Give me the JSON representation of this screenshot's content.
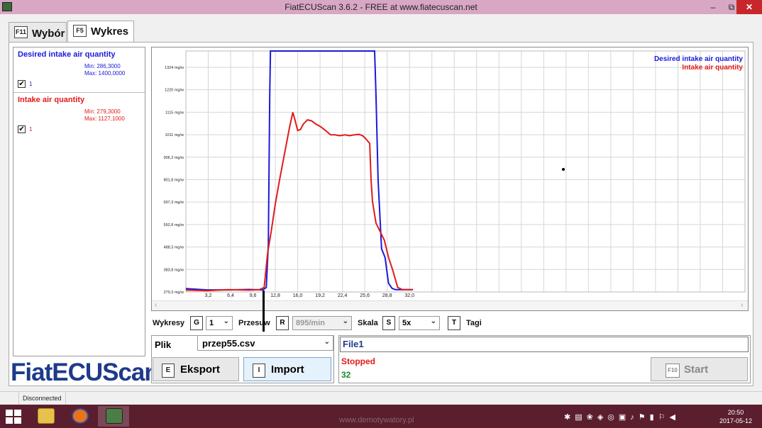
{
  "window": {
    "title": "FiatECUScan 3.6.2 - FREE at www.fiatecuscan.net",
    "min_glyph": "–",
    "max_glyph": "⧉",
    "close_glyph": "✕"
  },
  "tabs": [
    {
      "key": "F11",
      "label": "Wybór",
      "active": false
    },
    {
      "key": "F5",
      "label": "Wykres",
      "active": true
    }
  ],
  "legend": [
    {
      "name": "Desired intake air quantity",
      "color": "#1a1adb",
      "min": "Min: 286,3000",
      "max": "Max: 1400,0000",
      "checked": true,
      "num": "1",
      "check_glyph": "✔"
    },
    {
      "name": "Intake air quantity",
      "color": "#e01b1b",
      "min": "Min: 279,3000",
      "max": "Max: 1127,1000",
      "checked": true,
      "num": "1",
      "check_glyph": "✔"
    }
  ],
  "logo": "FiatECUScan",
  "chart_data": {
    "type": "line",
    "x_ticks": [
      "3,2",
      "6,4",
      "9,6",
      "12,8",
      "16,0",
      "19,2",
      "22,4",
      "25,6",
      "28,8",
      "32,0"
    ],
    "y_ticks": [
      "279,3 mg/w",
      "383,8 mg/w",
      "488,3 mg/w",
      "592,8 mg/w",
      "697,3 mg/w",
      "801,8 mg/w",
      "906,3 mg/w",
      "1011 mg/w",
      "1115 mg/w",
      "1220 mg/w",
      "1324 mg/w"
    ],
    "xlim": [
      0,
      80
    ],
    "ylim": [
      279.3,
      1400
    ],
    "grid": true,
    "legend_position": "top-right",
    "series": [
      {
        "name": "Desired intake air quantity",
        "color": "#1a1adb",
        "x": [
          0,
          3,
          6,
          9,
          11,
          11.5,
          11.8,
          12,
          12.1,
          27,
          27.2,
          27.5,
          28,
          28.5,
          29,
          29.5,
          30,
          31,
          32.5
        ],
        "y": [
          295,
          289,
          289,
          291,
          289,
          300,
          500,
          1200,
          1400,
          1400,
          1200,
          800,
          480,
          440,
          320,
          296,
          290,
          290,
          290
        ]
      },
      {
        "name": "Intake air quantity",
        "color": "#e01b1b",
        "x": [
          0,
          3,
          6,
          9,
          10.5,
          11.2,
          11.7,
          12.2,
          12.8,
          13.4,
          14.1,
          14.8,
          15.3,
          15.6,
          16.0,
          16.4,
          16.8,
          17.4,
          18.0,
          18.6,
          19.2,
          20.0,
          20.7,
          21.3,
          22.0,
          22.8,
          23.4,
          24.1,
          24.8,
          25.3,
          25.8,
          26.3,
          26.5,
          26.7,
          27.2,
          27.8,
          28.4,
          29.0,
          29.6,
          30.3,
          31.0,
          32.5
        ],
        "y": [
          288,
          285,
          290,
          288,
          290,
          300,
          460,
          560,
          690,
          800,
          920,
          1040,
          1115,
          1080,
          1030,
          1035,
          1060,
          1080,
          1075,
          1060,
          1050,
          1030,
          1010,
          1010,
          1006,
          1010,
          1006,
          1010,
          1012,
          1006,
          990,
          970,
          800,
          700,
          600,
          560,
          520,
          440,
          380,
          300,
          290,
          290
        ]
      }
    ]
  },
  "controls": {
    "wykresy_label": "Wykresy",
    "wykresy_key": "G",
    "wykresy_value": "1",
    "przesuw_label": "Przesuw",
    "przesuw_key": "R",
    "przesuw_value": "895/min",
    "skala_label": "Skala",
    "skala_key": "S",
    "skala_value": "5x",
    "tagi_key": "T",
    "tagi_label": "Tagi",
    "chev": "⌄"
  },
  "file": {
    "plik_label": "Plik",
    "selected": "przep55.csv",
    "eksport_key": "E",
    "eksport_label": "Eksport",
    "import_key": "I",
    "import_label": "Import",
    "filename": "File1",
    "status": "Stopped",
    "count": "32",
    "start_key": "F10",
    "start_label": "Start"
  },
  "statusbar": {
    "connection": "Disconnected"
  },
  "taskbar": {
    "watermark": "www.demotywatory.pl",
    "time": "20:50",
    "date": "2017-05-12",
    "tray_glyphs": "✱▤❀◈◎▣♪⚑▮⚐◀"
  }
}
